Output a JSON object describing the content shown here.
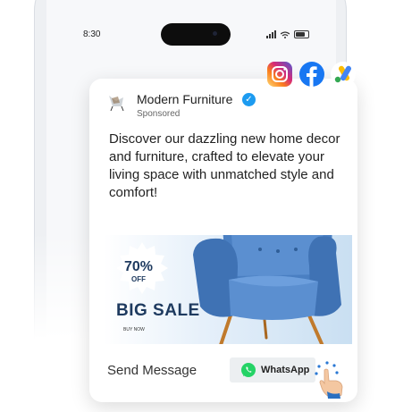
{
  "status_bar": {
    "time": "8:30"
  },
  "ad": {
    "brand_name": "Modern Furniture",
    "sponsored_label": "Sponsored",
    "copy": "Discover our dazzling new home decor and furniture, crafted to elevate your living space with unmatched style and comfort!",
    "banner": {
      "discount": "70%",
      "discount_suffix": "OFF",
      "headline": "BIG SALE",
      "cta_small": "BUY NOW"
    },
    "send_message_label": "Send Message",
    "whatsapp_label": "WhatsApp"
  },
  "social_icons": [
    "instagram-icon",
    "facebook-icon",
    "google-ads-icon"
  ],
  "colors": {
    "accent_blue": "#1d9bf0",
    "navy": "#1e3a5f",
    "chair_blue": "#4a7fc2",
    "whatsapp_green": "#25d366",
    "facebook_blue": "#1877f2"
  }
}
